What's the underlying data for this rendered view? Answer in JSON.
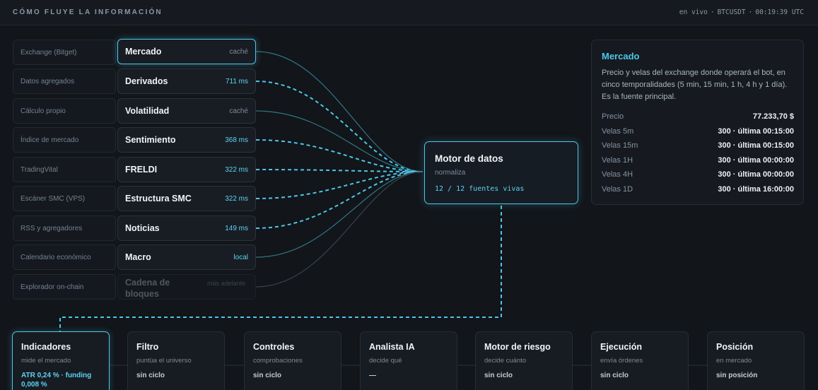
{
  "header": {
    "title": "CÓMO FLUYE LA INFORMACIÓN",
    "live": "en vivo",
    "pair": "BTCUSDT",
    "clock": "00:19:39 UTC"
  },
  "sources": [
    {
      "origin": "Exchange (Bitget)",
      "name": "Mercado",
      "meta": "caché",
      "link": "solid"
    },
    {
      "origin": "Datos agregados",
      "name": "Derivados",
      "meta": "711 ms",
      "link": "dashed"
    },
    {
      "origin": "Cálculo propio",
      "name": "Volatilidad",
      "meta": "caché",
      "link": "solid"
    },
    {
      "origin": "Índice de mercado",
      "name": "Sentimiento",
      "meta": "368 ms",
      "link": "dashed"
    },
    {
      "origin": "TradingVital",
      "name": "FRELDI",
      "meta": "322 ms",
      "link": "dashed"
    },
    {
      "origin": "Escáner SMC (VPS)",
      "name": "Estructura SMC",
      "meta": "322 ms",
      "link": "dashed"
    },
    {
      "origin": "RSS y agregadores",
      "name": "Noticias",
      "meta": "149 ms",
      "link": "dashed"
    },
    {
      "origin": "Calendario económico",
      "name": "Macro",
      "meta": "local",
      "link": "solid"
    },
    {
      "origin": "Explorador on-chain",
      "name": "Cadena de bloques",
      "meta": "más adelante",
      "link": "dim"
    }
  ],
  "motor": {
    "title": "Motor de datos",
    "subtitle": "normaliza",
    "live": "12 / 12 fuentes vivas"
  },
  "info": {
    "title": "Mercado",
    "description": "Precio y velas del exchange donde operará el bot, en cinco temporalidades (5 min, 15 min, 1 h, 4 h y 1 día). Es la fuente principal.",
    "rows": [
      {
        "key": "Precio",
        "value": "77.233,70 $"
      },
      {
        "key": "Velas 5m",
        "value": "300 · última 00:15:00"
      },
      {
        "key": "Velas 15m",
        "value": "300 · última 00:15:00"
      },
      {
        "key": "Velas 1H",
        "value": "300 · última 00:00:00"
      },
      {
        "key": "Velas 4H",
        "value": "300 · última 00:00:00"
      },
      {
        "key": "Velas 1D",
        "value": "300 · última 16:00:00"
      }
    ]
  },
  "pipeline": [
    {
      "title": "Indicadores",
      "subtitle": "mide el mercado",
      "value": "ATR 0,24 % · funding 0,008 %"
    },
    {
      "title": "Filtro",
      "subtitle": "puntúa el universo",
      "value": "sin ciclo"
    },
    {
      "title": "Controles",
      "subtitle": "comprobaciones",
      "value": "sin ciclo"
    },
    {
      "title": "Analista IA",
      "subtitle": "decide qué",
      "value": "—"
    },
    {
      "title": "Motor de riesgo",
      "subtitle": "decide cuánto",
      "value": "sin ciclo"
    },
    {
      "title": "Ejecución",
      "subtitle": "envía órdenes",
      "value": "sin ciclo"
    },
    {
      "title": "Posición",
      "subtitle": "en mercado",
      "value": "sin posición"
    }
  ],
  "colors": {
    "accent": "#4cc7ea",
    "background": "#121519",
    "panel": "#171c22"
  }
}
